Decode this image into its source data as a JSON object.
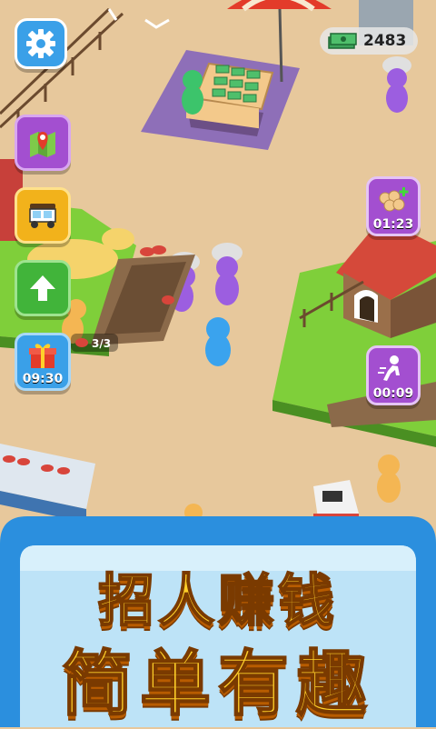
{
  "hud": {
    "money": "2483",
    "money_icon": "cash-stack-icon",
    "settings_icon": "gear-icon"
  },
  "side_menu": [
    {
      "name": "map",
      "icon": "map-pin-icon",
      "color": "#a34fd0"
    },
    {
      "name": "vehicle",
      "icon": "tuk-tuk-icon",
      "color": "#f2b21b"
    },
    {
      "name": "upgrade",
      "icon": "up-arrow-icon",
      "color": "#41b43a"
    },
    {
      "name": "gift",
      "icon": "gift-icon",
      "color": "#3aa0e8",
      "timer": "09:30"
    }
  ],
  "right_menu": [
    {
      "name": "bread-boost",
      "icon": "bread-plus-icon",
      "timer": "01:23"
    },
    {
      "name": "speed-boost",
      "icon": "running-man-icon",
      "timer": "00:09"
    }
  ],
  "station": {
    "meat_count": "3/3",
    "meat_icon": "steak-icon"
  },
  "banner": {
    "line1": "招人赚钱",
    "line2": "简单有趣"
  },
  "colors": {
    "ground": "#e7c89c",
    "grass": "#7fcf3a",
    "purple_zone": "#8e6fb8",
    "banner_blue": "#2b8fde",
    "banner_panel": "#bde3f7",
    "title_yellow": "#ffd02a"
  }
}
